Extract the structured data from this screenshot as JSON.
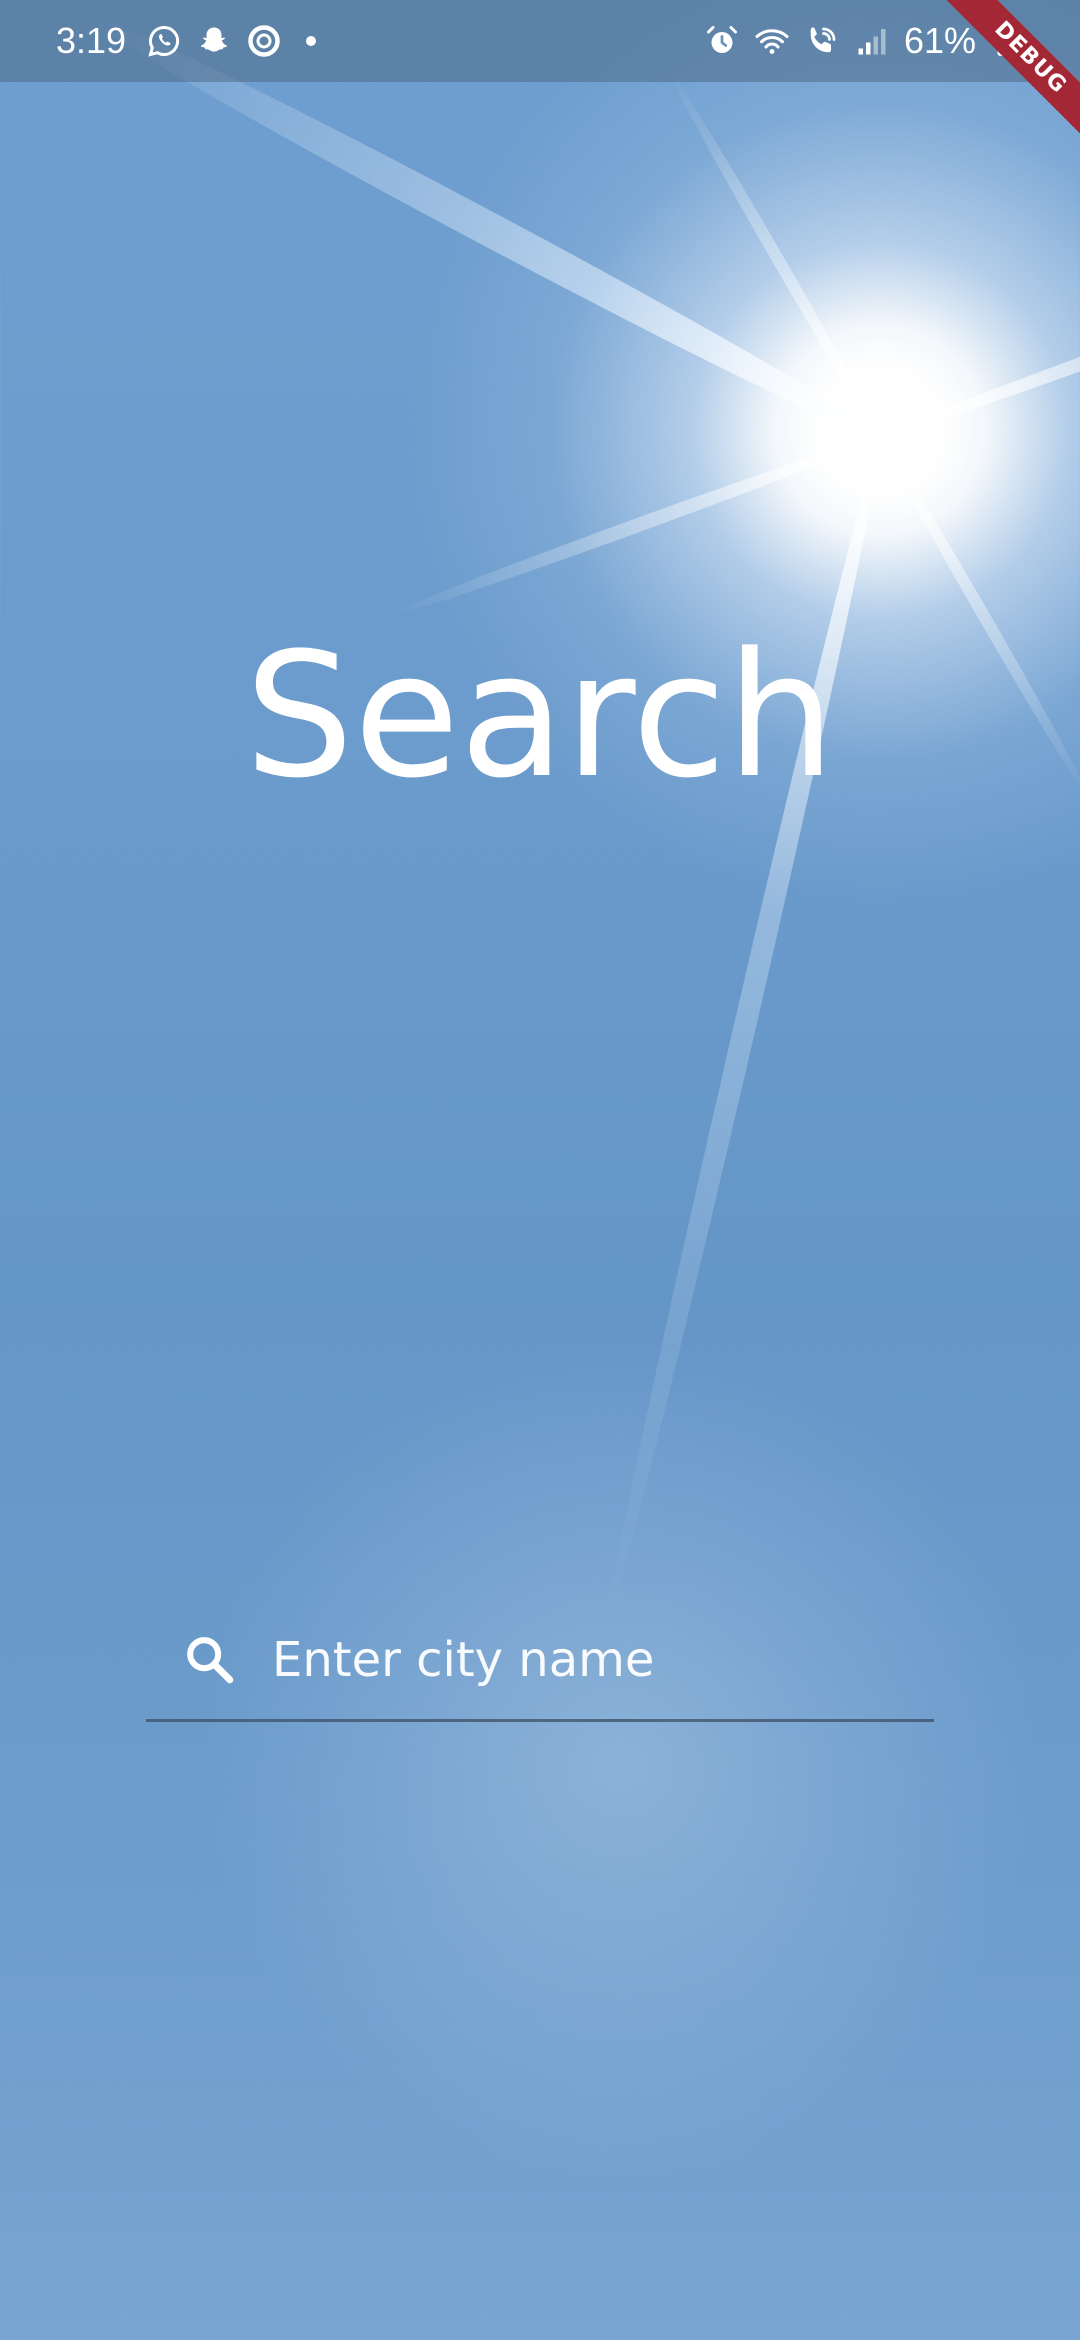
{
  "status_bar": {
    "time": "3:19",
    "battery_percent": "61%",
    "left_icons": [
      "whatsapp-icon",
      "snapchat-icon",
      "ring-app-icon",
      "notification-dot-icon"
    ],
    "right_icons": [
      "alarm-icon",
      "wifi-icon",
      "wifi-calling-icon",
      "signal-icon",
      "battery-icon"
    ]
  },
  "debug_banner": {
    "label": "DEBUG"
  },
  "page": {
    "title": "Search"
  },
  "search": {
    "placeholder": "Enter city name",
    "value": ""
  },
  "colors": {
    "sky_blue": "#6c9ccd",
    "text": "#ffffff",
    "underline": "#3c5064",
    "debug_banner": "#a32734"
  }
}
